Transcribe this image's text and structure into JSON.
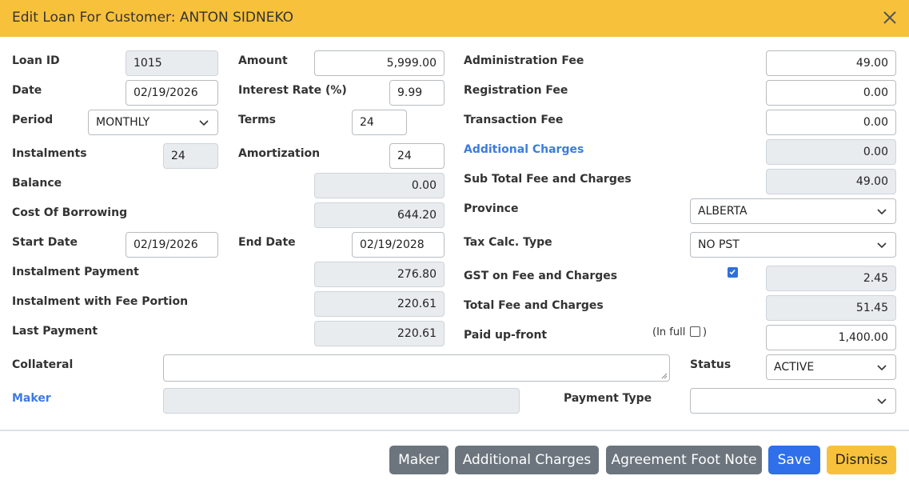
{
  "dialog": {
    "title": "Edit Loan For Customer: ANTON SIDNEKO",
    "close_icon": "close-icon"
  },
  "left": {
    "loan_id": {
      "label": "Loan ID",
      "value": "1015"
    },
    "date": {
      "label": "Date",
      "value": "02/19/2026"
    },
    "period": {
      "label": "Period",
      "value": "MONTHLY"
    },
    "instalments": {
      "label": "Instalments",
      "value": "24"
    },
    "balance": {
      "label": "Balance"
    },
    "cost_of_borrowing": {
      "label": "Cost Of Borrowing"
    },
    "start_date": {
      "label": "Start Date",
      "value": "02/19/2026"
    },
    "instalment_payment": {
      "label": "Instalment Payment"
    },
    "instalment_fee_portion": {
      "label": "Instalment with Fee Portion"
    },
    "last_payment": {
      "label": "Last Payment"
    },
    "collateral": {
      "label": "Collateral",
      "value": ""
    },
    "maker": {
      "label": "Maker",
      "value": ""
    }
  },
  "middle": {
    "amount": {
      "label": "Amount",
      "value": "5,999.00"
    },
    "interest_rate": {
      "label": "Interest Rate (%)",
      "value": "9.99"
    },
    "terms": {
      "label": "Terms",
      "value": "24"
    },
    "amortization": {
      "label": "Amortization",
      "value": "24"
    },
    "balance_value": "0.00",
    "cost_of_borrowing_value": "644.20",
    "end_date": {
      "label": "End Date",
      "value": "02/19/2028"
    },
    "instalment_payment_value": "276.80",
    "instalment_fee_portion_value": "220.61",
    "last_payment_value": "220.61"
  },
  "right": {
    "administration_fee": {
      "label": "Administration Fee",
      "value": "49.00"
    },
    "registration_fee": {
      "label": "Registration Fee",
      "value": "0.00"
    },
    "transaction_fee": {
      "label": "Transaction Fee",
      "value": "0.00"
    },
    "additional_charges": {
      "label": "Additional Charges",
      "value": "0.00"
    },
    "sub_total": {
      "label": "Sub Total Fee and Charges",
      "value": "49.00"
    },
    "province": {
      "label": "Province",
      "value": "ALBERTA"
    },
    "tax_calc_type": {
      "label": "Tax Calc. Type",
      "value": "NO PST"
    },
    "gst": {
      "label": "GST on Fee and Charges",
      "value": "2.45",
      "checked": true
    },
    "total_fee": {
      "label": "Total Fee and Charges",
      "value": "51.45"
    },
    "paid_upfront": {
      "label": "Paid up-front",
      "in_full_label": "(In full",
      "in_full_close": ")",
      "in_full_checked": false,
      "value": "1,400.00"
    },
    "status": {
      "label": "Status",
      "value": "ACTIVE"
    },
    "payment_type": {
      "label": "Payment Type",
      "value": ""
    }
  },
  "footer": {
    "maker_button": "Maker",
    "additional_charges_button": "Additional Charges",
    "agreement_foot_note_button": "Agreement Foot Note",
    "save_button": "Save",
    "dismiss_button": "Dismiss"
  },
  "colors": {
    "header": "#f7c13c",
    "link": "#3d7be0",
    "primary": "#2f6fea",
    "secondary": "#6c757d"
  }
}
